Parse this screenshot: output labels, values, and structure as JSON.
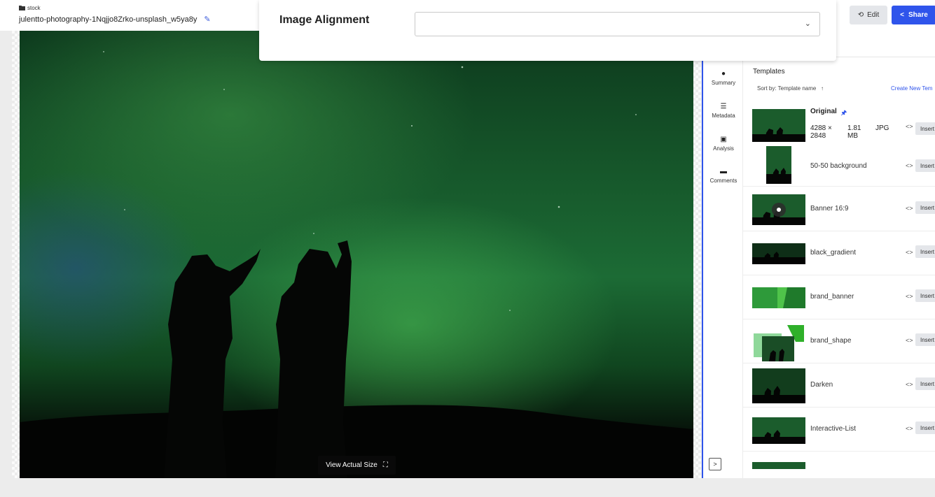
{
  "header": {
    "folder": "stock",
    "filename": "julentto-photography-1Nqjjo8Zrko-unsplash_w5ya8y",
    "edit_label": "Edit",
    "share_label": "Share"
  },
  "alignment_panel": {
    "label": "Image Alignment",
    "selected": ""
  },
  "viewer": {
    "view_actual_label": "View Actual Size"
  },
  "side_tabs": [
    {
      "label": "Summary",
      "icon": "info-icon"
    },
    {
      "label": "Metadata",
      "icon": "list-icon"
    },
    {
      "label": "Analysis",
      "icon": "image-analysis-icon"
    },
    {
      "label": "Comments",
      "icon": "comments-icon"
    }
  ],
  "templates": {
    "title": "Templates",
    "sort_label": "Sort by: Template name",
    "create_new_label": "Create New Tem",
    "original": {
      "name": "Original",
      "width": "4288 ×",
      "height": "2848",
      "size_value": "1.81",
      "size_unit": "MB",
      "format": "JPG"
    },
    "insert_label": "Insert",
    "items": [
      {
        "name": "50-50 background"
      },
      {
        "name": "Banner 16:9"
      },
      {
        "name": "black_gradient"
      },
      {
        "name": "brand_banner"
      },
      {
        "name": "brand_shape"
      },
      {
        "name": "Darken"
      },
      {
        "name": "Interactive-List"
      }
    ]
  }
}
